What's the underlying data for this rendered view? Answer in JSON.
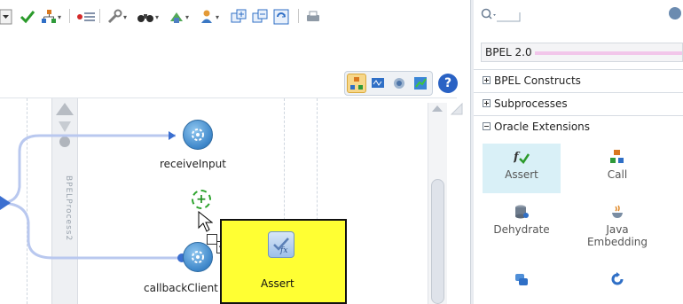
{
  "palette": {
    "dropdown_value": "BPEL 2.0",
    "sections": [
      {
        "label": "BPEL Constructs",
        "expanded": false
      },
      {
        "label": "Subprocesses",
        "expanded": false
      },
      {
        "label": "Oracle Extensions",
        "expanded": true
      }
    ],
    "items": [
      {
        "label": "Assert",
        "icon": "assert-icon",
        "selected": true
      },
      {
        "label": "Call",
        "icon": "call-icon"
      },
      {
        "label": "Dehydrate",
        "icon": "dehydrate-icon"
      },
      {
        "label": "Java\nEmbedding",
        "icon": "java-embedding-icon"
      },
      {
        "label": "",
        "icon": "replay-icon"
      },
      {
        "label": "",
        "icon": "refresh-icon"
      }
    ]
  },
  "canvas": {
    "lane_label": "BPELProcess2",
    "nodes": [
      {
        "label": "receiveInput"
      },
      {
        "label": "callbackClient"
      }
    ],
    "drag_tooltip": {
      "label": "Assert"
    }
  },
  "colors": {
    "drag_tooltip_bg": "#ffff33",
    "selected_item_bg": "#d9f0f7",
    "node_blue": "#3d86c9"
  }
}
